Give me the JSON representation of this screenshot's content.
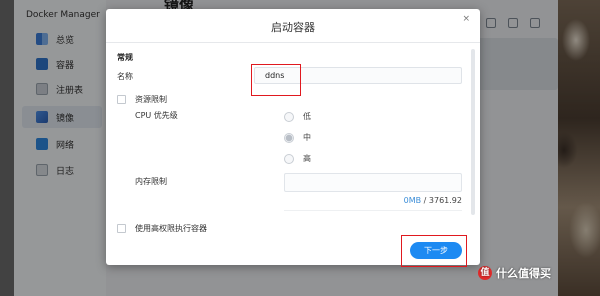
{
  "app": {
    "title": "Docker Manager",
    "page_heading": "镜像"
  },
  "sidebar": {
    "items": [
      {
        "label": "总览",
        "icon": "overview-icon"
      },
      {
        "label": "容器",
        "icon": "container-icon"
      },
      {
        "label": "注册表",
        "icon": "registry-icon"
      },
      {
        "label": "镜像",
        "icon": "image-icon",
        "active": true
      },
      {
        "label": "网络",
        "icon": "network-icon"
      },
      {
        "label": "日志",
        "icon": "log-icon"
      }
    ]
  },
  "dialog": {
    "title": "启动容器",
    "close_icon": "×",
    "section_general": "常规",
    "name_label": "名称",
    "name_value": "ddns",
    "resource_limit_label": "资源限制",
    "cpu_priority_label": "CPU 优先级",
    "cpu_options": [
      "低",
      "中",
      "高"
    ],
    "cpu_selected": "中",
    "memory_limit_label": "内存限制",
    "memory_used": "0MB",
    "memory_separator": "/",
    "memory_total": "3761.92",
    "high_privilege_label": "使用高权限执行容器",
    "next_button": "下一步"
  },
  "colors": {
    "accent": "#1d8af2",
    "highlight": "#e0191f",
    "memory_used": "#3c8ed8"
  },
  "watermark": {
    "text": "什么值得买",
    "badge": "值"
  }
}
